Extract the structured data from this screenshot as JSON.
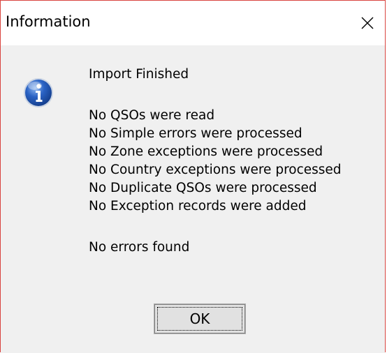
{
  "window": {
    "title": "Information",
    "close_glyph": "close-icon"
  },
  "message": {
    "icon": "info-icon",
    "heading": "Import Finished",
    "lines": [
      "No QSOs were read",
      "No Simple errors were processed",
      "No Zone exceptions were processed",
      "No Country exceptions were processed",
      "No Duplicate QSOs were processed",
      "No Exception records were added"
    ],
    "footer": "No errors found"
  },
  "buttons": {
    "ok_label": "OK"
  },
  "colors": {
    "border": "#d9443f",
    "dialog_bg": "#f0f0f0",
    "titlebar_bg": "#ffffff",
    "icon_blue": "#1a4fa3"
  }
}
